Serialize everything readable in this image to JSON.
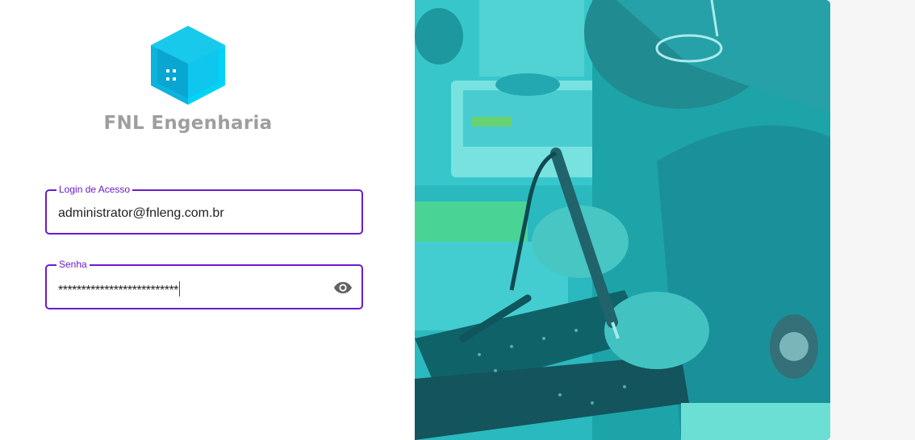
{
  "brand": {
    "name": "FNL Engenharia",
    "logo_icon": "isometric-cube-building-icon",
    "logo_colors": [
      "#12c3e6",
      "#00a8d0",
      "#0089b5"
    ]
  },
  "login_field": {
    "label": "Login de Acesso",
    "value": "administrator@fnleng.com.br"
  },
  "password_field": {
    "label": "Senha",
    "value": "**************************",
    "toggle_icon": "eye-icon"
  },
  "theme": {
    "accent": "#6a1bc9",
    "photo_overlay": "#15c3c8"
  },
  "hero_image": {
    "description_icon": "soldering-pcb-photo"
  }
}
